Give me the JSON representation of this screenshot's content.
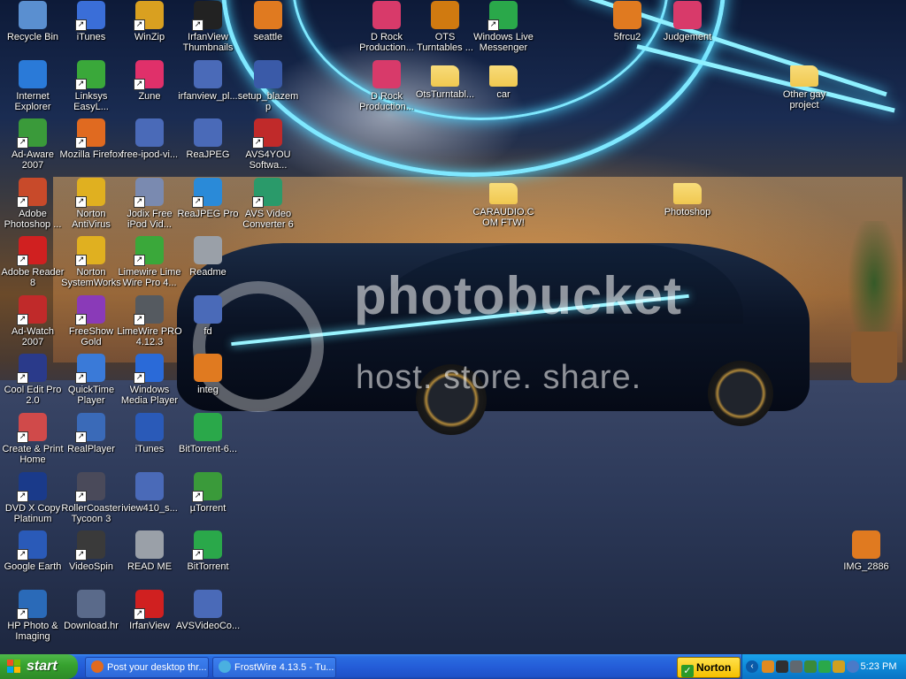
{
  "desktop": {
    "icons": [
      {
        "label": "Recycle Bin",
        "icon": "recycle-bin-icon",
        "shortcut": false,
        "color": "#5a8fd0"
      },
      {
        "label": "iTunes",
        "icon": "itunes-icon",
        "shortcut": true,
        "color": "#3a6ed8"
      },
      {
        "label": "WinZip",
        "icon": "winzip-icon",
        "shortcut": true,
        "color": "#d9a020"
      },
      {
        "label": "IrfanView Thumbnails",
        "icon": "irfanview-panda-icon",
        "shortcut": true,
        "color": "#222222"
      },
      {
        "label": "seattle",
        "icon": "image-file-icon",
        "shortcut": false,
        "color": "#e07a20"
      },
      {
        "label": "D Rock Production...",
        "icon": "mp3-file-icon",
        "shortcut": false,
        "color": "#d83a6a"
      },
      {
        "label": "OTS Turntables ...",
        "icon": "ots-turntables-icon",
        "shortcut": false,
        "color": "#d07a10"
      },
      {
        "label": "Windows Live Messenger",
        "icon": "messenger-icon",
        "shortcut": true,
        "color": "#2aa84a"
      },
      {
        "label": "5frcu2",
        "icon": "image-file-icon",
        "shortcut": false,
        "color": "#e07a20"
      },
      {
        "label": "Judgement",
        "icon": "mp3-file-icon",
        "shortcut": false,
        "color": "#d83a6a"
      },
      {
        "label": "Internet Explorer",
        "icon": "internet-explorer-icon",
        "shortcut": false,
        "color": "#2a7ad8"
      },
      {
        "label": "Linksys EasyL...",
        "icon": "linksys-icon",
        "shortcut": true,
        "color": "#3aa83a"
      },
      {
        "label": "Zune",
        "icon": "zune-icon",
        "shortcut": true,
        "color": "#e0306a"
      },
      {
        "label": "irfanview_pl...",
        "icon": "installer-icon",
        "shortcut": false,
        "color": "#4a6ab8"
      },
      {
        "label": "setup_blazemp",
        "icon": "setup-icon",
        "shortcut": false,
        "color": "#3a5aa8"
      },
      {
        "label": "D Rock Production...",
        "icon": "mp3-file-icon",
        "shortcut": false,
        "color": "#d83a6a"
      },
      {
        "label": "OtsTurntabl...",
        "icon": "folder-icon",
        "shortcut": false,
        "color": "#f0c850"
      },
      {
        "label": "car",
        "icon": "folder-icon",
        "shortcut": false,
        "color": "#f0c850"
      },
      {
        "label": "Other gay project",
        "icon": "folder-icon",
        "shortcut": false,
        "color": "#f0c850"
      },
      {
        "label": "Ad-Aware 2007",
        "icon": "ad-aware-icon",
        "shortcut": true,
        "color": "#3a9a3a"
      },
      {
        "label": "Mozilla Firefox",
        "icon": "firefox-icon",
        "shortcut": true,
        "color": "#e06a20"
      },
      {
        "label": "free-ipod-vi...",
        "icon": "installer-icon",
        "shortcut": false,
        "color": "#4a6ab8"
      },
      {
        "label": "ReaJPEG",
        "icon": "installer-icon",
        "shortcut": false,
        "color": "#4a6ab8"
      },
      {
        "label": "AVS4YOU Softwa...",
        "icon": "avs4you-icon",
        "shortcut": true,
        "color": "#c02a2a"
      },
      {
        "label": "Adobe Photoshop ...",
        "icon": "photoshop-icon",
        "shortcut": true,
        "color": "#c84a2a"
      },
      {
        "label": "Norton AntiVirus",
        "icon": "norton-icon",
        "shortcut": true,
        "color": "#e0b020"
      },
      {
        "label": "Jodix Free iPod Vid...",
        "icon": "jodix-icon",
        "shortcut": true,
        "color": "#7a8ab0"
      },
      {
        "label": "ReaJPEG Pro",
        "icon": "reajpeg-icon",
        "shortcut": true,
        "color": "#2a8ad8"
      },
      {
        "label": "AVS Video Converter 6",
        "icon": "avs-video-icon",
        "shortcut": true,
        "color": "#2a9a6a"
      },
      {
        "label": "CARAUDIO.COM FTW!",
        "icon": "folder-icon",
        "shortcut": false,
        "color": "#f0c850"
      },
      {
        "label": "Photoshop",
        "icon": "folder-icon",
        "shortcut": false,
        "color": "#f0c850"
      },
      {
        "label": "Adobe Reader 8",
        "icon": "adobe-reader-icon",
        "shortcut": true,
        "color": "#d02020"
      },
      {
        "label": "Norton SystemWorks",
        "icon": "norton-icon",
        "shortcut": true,
        "color": "#e0b020"
      },
      {
        "label": "Limewire Lime Wire Pro 4...",
        "icon": "limewire-icon",
        "shortcut": true,
        "color": "#3aa83a"
      },
      {
        "label": "Readme",
        "icon": "text-file-icon",
        "shortcut": false,
        "color": "#9aa0a8"
      },
      {
        "label": "Ad-Watch 2007",
        "icon": "ad-watch-icon",
        "shortcut": true,
        "color": "#c02a2a"
      },
      {
        "label": "FreeShow Gold",
        "icon": "proshow-icon",
        "shortcut": true,
        "color": "#8a3ab8"
      },
      {
        "label": "LimeWire PRO 4.12.3",
        "icon": "limewire-app-icon",
        "shortcut": true,
        "color": "#555a60"
      },
      {
        "label": "fd",
        "icon": "installer-icon",
        "shortcut": false,
        "color": "#4a6ab8"
      },
      {
        "label": "Cool Edit Pro 2.0",
        "icon": "cool-edit-icon",
        "shortcut": true,
        "color": "#2a3a8a"
      },
      {
        "label": "QuickTime Player",
        "icon": "quicktime-icon",
        "shortcut": true,
        "color": "#3a7ad8"
      },
      {
        "label": "Windows Media Player",
        "icon": "media-player-icon",
        "shortcut": true,
        "color": "#2a6ad8"
      },
      {
        "label": "integ",
        "icon": "image-file-icon",
        "shortcut": false,
        "color": "#e07a20"
      },
      {
        "label": "Create & Print Home",
        "icon": "create-print-icon",
        "shortcut": true,
        "color": "#d04a4a"
      },
      {
        "label": "RealPlayer",
        "icon": "realplayer-icon",
        "shortcut": true,
        "color": "#3a6ab8"
      },
      {
        "label": "iTunes",
        "icon": "application-icon",
        "shortcut": false,
        "color": "#2a5ab8"
      },
      {
        "label": "BitTorrent-6...",
        "icon": "bittorrent-icon",
        "shortcut": false,
        "color": "#2aa84a"
      },
      {
        "label": "DVD X Copy Platinum",
        "icon": "dvd-x-copy-icon",
        "shortcut": true,
        "color": "#1a3a8a"
      },
      {
        "label": "RollerCoaster Tycoon 3",
        "icon": "rollercoaster-icon",
        "shortcut": true,
        "color": "#4a4a5a"
      },
      {
        "label": "iview410_s...",
        "icon": "installer-icon",
        "shortcut": false,
        "color": "#4a6ab8"
      },
      {
        "label": "µTorrent",
        "icon": "utorrent-icon",
        "shortcut": true,
        "color": "#3a9a3a"
      },
      {
        "label": "Google Earth",
        "icon": "google-earth-icon",
        "shortcut": true,
        "color": "#2a5ab8"
      },
      {
        "label": "VideoSpin",
        "icon": "videospin-icon",
        "shortcut": true,
        "color": "#3a3a3a"
      },
      {
        "label": "READ ME",
        "icon": "text-file-icon",
        "shortcut": false,
        "color": "#9aa0a8"
      },
      {
        "label": "BitTorrent",
        "icon": "bittorrent-icon",
        "shortcut": true,
        "color": "#2aa84a"
      },
      {
        "label": "IMG_2886",
        "icon": "image-file-icon",
        "shortcut": false,
        "color": "#e07a20"
      },
      {
        "label": "HP Photo & Imaging",
        "icon": "hp-photo-icon",
        "shortcut": true,
        "color": "#2a6ab8"
      },
      {
        "label": "Download.hr",
        "icon": "application-icon",
        "shortcut": false,
        "color": "#5a6a8a"
      },
      {
        "label": "IrfanView",
        "icon": "irfanview-icon",
        "shortcut": true,
        "color": "#d02020"
      },
      {
        "label": "AVSVideoCo...",
        "icon": "installer-icon",
        "shortcut": false,
        "color": "#4a6ab8"
      }
    ],
    "wallpaper_watermark": {
      "line1": "photobucket",
      "line2": "host. store. share."
    }
  },
  "taskbar": {
    "start_label": "start",
    "tasks": [
      {
        "label": "Post your desktop thr...",
        "icon": "firefox-icon",
        "color": "#e06a20"
      },
      {
        "label": "FrostWire 4.13.5 - Tu...",
        "icon": "frostwire-icon",
        "color": "#4ab0e0"
      }
    ],
    "norton_label": "Norton",
    "tray_icons": [
      "network-icon",
      "norton-shield-icon",
      "speaker-icon",
      "security-icon",
      "msn-icon",
      "update-icon",
      "quicktime-tray-icon"
    ],
    "clock": "5:23 PM"
  },
  "colors": {
    "taskbar_blue": "#245dd8",
    "start_green": "#36a12e",
    "tray_blue": "#0f8ad8",
    "neon": "#7fe8ff"
  }
}
